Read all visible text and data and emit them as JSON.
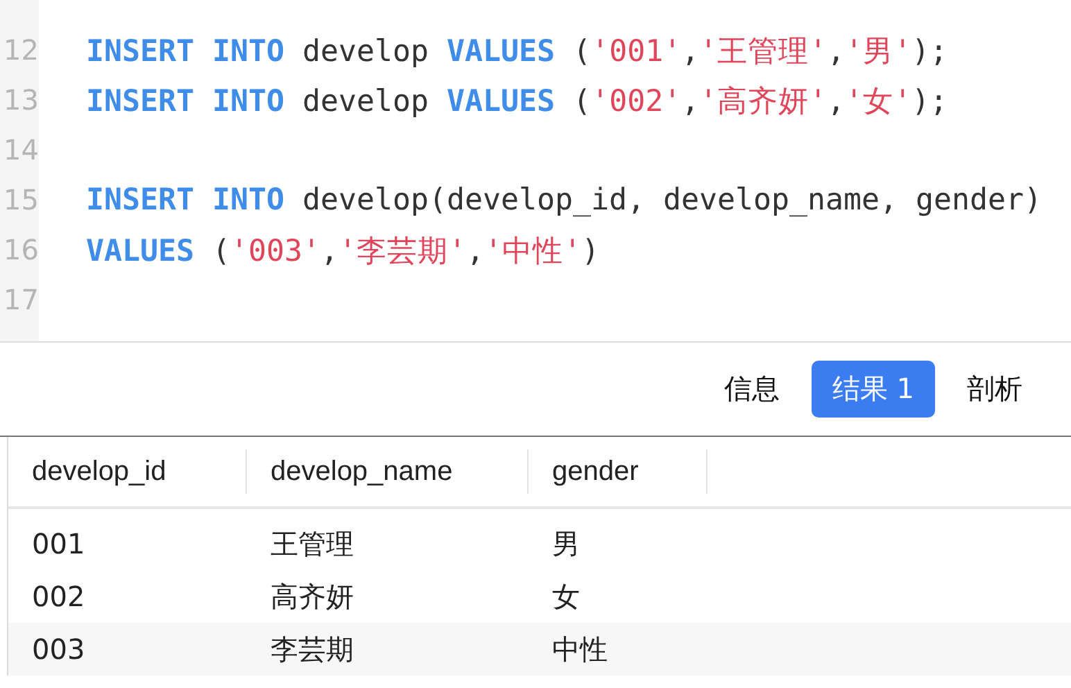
{
  "editor": {
    "lines": [
      {
        "number": "12",
        "tokens": [
          {
            "kind": "keyword",
            "text": "INSERT INTO"
          },
          {
            "kind": "plain",
            "text": " develop "
          },
          {
            "kind": "keyword",
            "text": "VALUES"
          },
          {
            "kind": "plain",
            "text": " ("
          },
          {
            "kind": "string",
            "text": "'001'"
          },
          {
            "kind": "plain",
            "text": ","
          },
          {
            "kind": "string",
            "text": "'王管理'"
          },
          {
            "kind": "plain",
            "text": ","
          },
          {
            "kind": "string",
            "text": "'男'"
          },
          {
            "kind": "plain",
            "text": ");"
          }
        ]
      },
      {
        "number": "13",
        "tokens": [
          {
            "kind": "keyword",
            "text": "INSERT INTO"
          },
          {
            "kind": "plain",
            "text": " develop "
          },
          {
            "kind": "keyword",
            "text": "VALUES"
          },
          {
            "kind": "plain",
            "text": " ("
          },
          {
            "kind": "string",
            "text": "'002'"
          },
          {
            "kind": "plain",
            "text": ","
          },
          {
            "kind": "string",
            "text": "'高齐妍'"
          },
          {
            "kind": "plain",
            "text": ","
          },
          {
            "kind": "string",
            "text": "'女'"
          },
          {
            "kind": "plain",
            "text": ");"
          }
        ]
      },
      {
        "number": "14"
      },
      {
        "number": "15",
        "tokens": [
          {
            "kind": "keyword",
            "text": "INSERT INTO"
          },
          {
            "kind": "plain",
            "text": " develop(develop_id, develop_name, gender)"
          }
        ]
      },
      {
        "number": "16",
        "tokens": [
          {
            "kind": "keyword",
            "text": "VALUES"
          },
          {
            "kind": "plain",
            "text": " ("
          },
          {
            "kind": "string",
            "text": "'003'"
          },
          {
            "kind": "plain",
            "text": ","
          },
          {
            "kind": "string",
            "text": "'李芸期'"
          },
          {
            "kind": "plain",
            "text": ","
          },
          {
            "kind": "string",
            "text": "'中性'"
          },
          {
            "kind": "plain",
            "text": ")"
          }
        ]
      },
      {
        "number": "17"
      }
    ]
  },
  "result_tabs": [
    {
      "label": "信息",
      "selected": false
    },
    {
      "label": "结果 1",
      "selected": true
    },
    {
      "label": "剖析",
      "selected": false
    }
  ],
  "table": {
    "columns": [
      "develop_id",
      "develop_name",
      "gender"
    ],
    "rows": [
      [
        "001",
        "王管理",
        "男"
      ],
      [
        "002",
        "高齐妍",
        "女"
      ],
      [
        "003",
        "李芸期",
        "中性"
      ]
    ]
  }
}
